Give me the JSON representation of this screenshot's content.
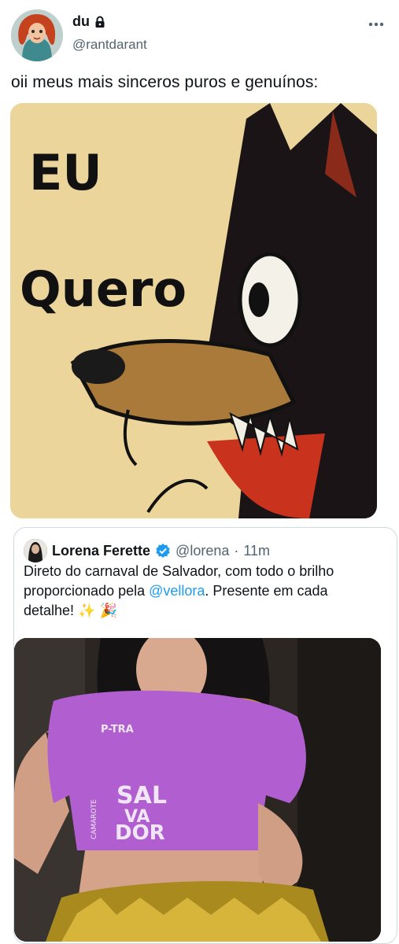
{
  "tweet": {
    "author_name": "du",
    "author_handle": "@rantdarant",
    "text": "oii meus mais sinceros puros e genuínos:",
    "media_meme_text": [
      "EU",
      "Quero"
    ]
  },
  "icons": {
    "lock": "lock-icon",
    "more": "more-horizontal-icon",
    "verified": "verified-badge-icon",
    "emoji_sparkles": "✨",
    "emoji_party": "🎉"
  },
  "quote": {
    "author_name": "Lorena Ferette",
    "author_handle": "@lorena",
    "separator": "·",
    "time": "11m",
    "text_before": "Direto do carnaval de Salvador, com todo o brilho proporcionado pela ",
    "mention": "@vellora",
    "text_after": ". Presente em cada detalhe! ",
    "shirt_text": [
      "P-TRA",
      "SAL",
      "VA",
      "DOR",
      "CAMAROTE"
    ]
  },
  "colors": {
    "link": "#1d9bf0",
    "secondary_text": "#536471",
    "verified": "#1d9bf0",
    "shirt": "#b15fd0",
    "tinsel": "#c9a32a"
  }
}
